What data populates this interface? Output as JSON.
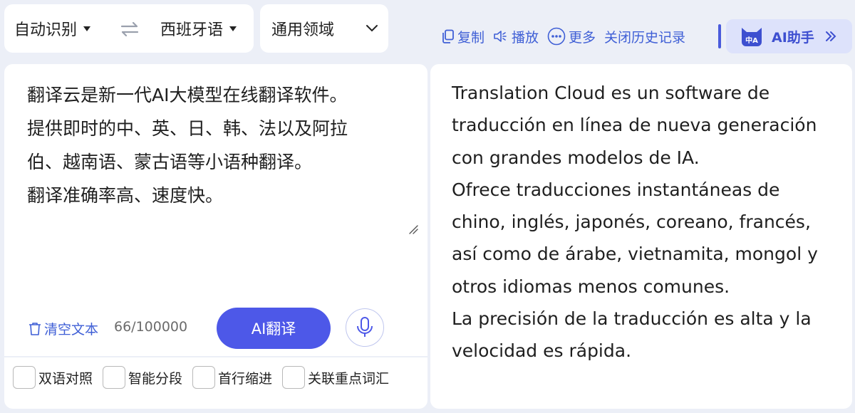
{
  "language_bar": {
    "source_language": "自动识别",
    "target_language": "西班牙语"
  },
  "domain_select": {
    "selected": "通用领域"
  },
  "toolbar": {
    "copy_label": "复制",
    "play_label": "播放",
    "more_label": "更多",
    "history_label": "关闭历史记录",
    "ai_assistant_label": "AI助手",
    "ai_badge_text": "中A"
  },
  "source": {
    "lines": [
      "翻译云是新一代AI大模型在线翻译软件。",
      "提供即时的中、英、日、韩、法以及阿拉",
      "伯、越南语、蒙古语等小语种翻译。",
      "翻译准确率高、速度快。"
    ],
    "clear_label": "清空文本",
    "char_count": "66/100000",
    "translate_label": "AI翻译"
  },
  "options": [
    {
      "label": "双语对照",
      "checked": false
    },
    {
      "label": "智能分段",
      "checked": false
    },
    {
      "label": "首行缩进",
      "checked": false
    },
    {
      "label": "关联重点词汇",
      "checked": false
    }
  ],
  "target": {
    "lines": [
      "Translation Cloud es un software de",
      "traducción en línea de nueva generación",
      "con grandes modelos de IA.",
      "Ofrece traducciones instantáneas de",
      "chino, inglés, japonés, coreano, francés,",
      "así como de árabe, vietnamita, mongol y",
      "otros idiomas menos comunes.",
      "La precisión de la traducción es alta y la",
      "velocidad es rápida."
    ]
  },
  "colors": {
    "accent": "#4d58e8",
    "link": "#3f5fd6",
    "background": "#eceff7"
  }
}
